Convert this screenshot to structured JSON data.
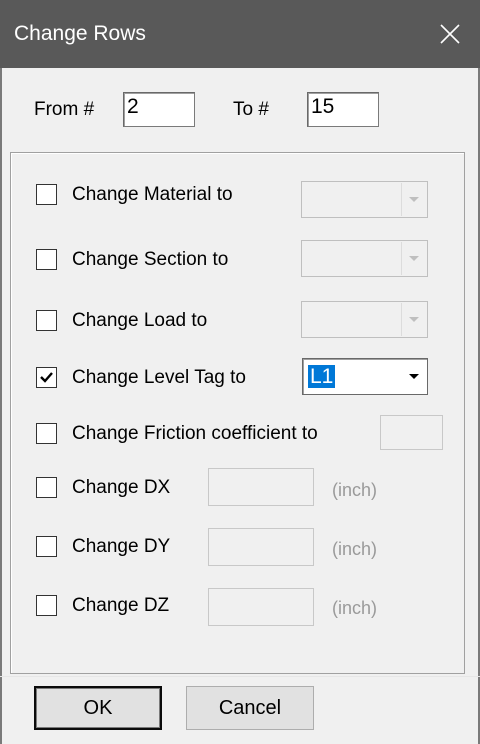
{
  "window": {
    "title": "Change Rows",
    "close_icon": "close-icon"
  },
  "range": {
    "from_label": "From #",
    "from_value": "2",
    "to_label": "To #",
    "to_value": "15"
  },
  "options": [
    {
      "label": "Change Material to",
      "checked": false,
      "value": ""
    },
    {
      "label": "Change Section to",
      "checked": false,
      "value": ""
    },
    {
      "label": "Change Load to",
      "checked": false,
      "value": ""
    },
    {
      "label": "Change Level Tag to",
      "checked": true,
      "value": "L1"
    },
    {
      "label": "Change Friction coefficient to",
      "checked": false,
      "value": ""
    },
    {
      "label": "Change DX",
      "checked": false,
      "value": "",
      "unit": "(inch)"
    },
    {
      "label": "Change DY",
      "checked": false,
      "value": "",
      "unit": "(inch)"
    },
    {
      "label": "Change DZ",
      "checked": false,
      "value": "",
      "unit": "(inch)"
    }
  ],
  "buttons": {
    "ok_label": "OK",
    "cancel_label": "Cancel"
  },
  "colors": {
    "titlebar": "#595959",
    "selection": "#0078d7",
    "dialog_bg": "#f0f0f0"
  }
}
